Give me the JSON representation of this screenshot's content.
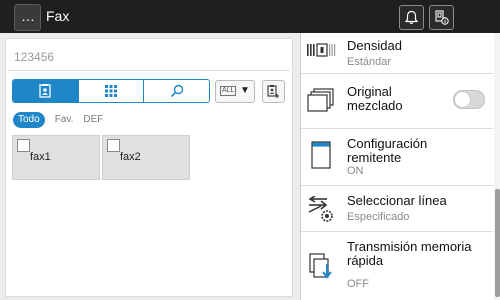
{
  "header": {
    "menu_icon_glyph": "…",
    "title": "Fax",
    "icons": [
      "bell-icon",
      "device-info-icon"
    ]
  },
  "left": {
    "number_field": "123456",
    "segments": [
      {
        "icon": "address-book-icon",
        "active": true
      },
      {
        "icon": "keypad-icon",
        "active": false
      },
      {
        "icon": "search-icon",
        "active": false
      }
    ],
    "all_label": "ALL",
    "all_arrow": "▼",
    "filter_tabs": [
      "Todo",
      "Fav.",
      "DEF"
    ],
    "entries": [
      "fax1",
      "fax2"
    ]
  },
  "right": {
    "items": [
      {
        "label": "Densidad",
        "sub": "Estándar",
        "icon": "density-icon"
      },
      {
        "label": "Original mezclado",
        "icon": "mixed-original-icon",
        "toggle": "off"
      },
      {
        "label": "Configuración remitente",
        "sub": "ON",
        "icon": "sender-settings-icon"
      },
      {
        "label": "Seleccionar línea",
        "sub": "Especificado",
        "icon": "line-select-icon"
      },
      {
        "label": "Transmisión memoria rápida",
        "sub": "OFF",
        "icon": "quick-memory-tx-icon"
      }
    ]
  },
  "colors": {
    "accent": "#1f86c8",
    "topbar": "#1f1f1f"
  }
}
